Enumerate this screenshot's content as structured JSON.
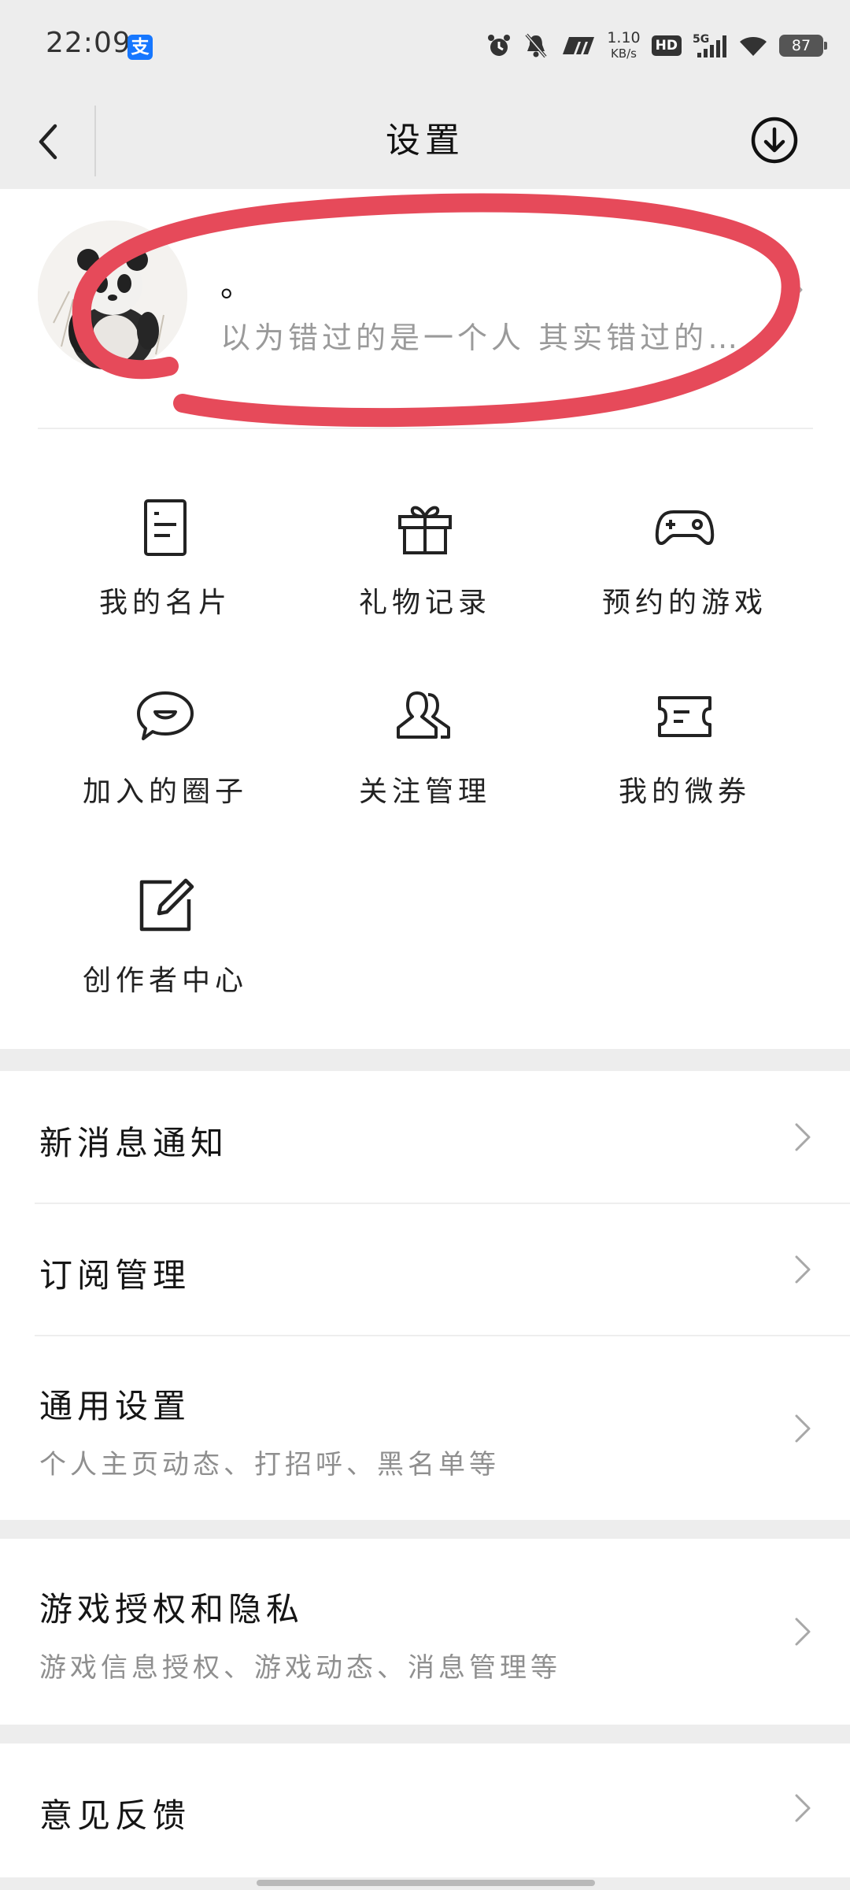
{
  "status_bar": {
    "time": "22:09",
    "alipay_icon_text": "支",
    "net_speed_value": "1.10",
    "net_speed_unit": "KB/s",
    "hd_label": "HD",
    "network_label": "5G",
    "battery": "87"
  },
  "header": {
    "title": "设置",
    "back_icon": "chevron-left-icon",
    "download_icon": "download-circle-icon"
  },
  "profile": {
    "avatar_icon": "panda-avatar",
    "nickname": "。",
    "signature": "以为错过的是一个人 其实错过的…",
    "annotation_color": "#e64a5a"
  },
  "grid": [
    {
      "label": "我的名片",
      "icon": "card-document-icon"
    },
    {
      "label": "礼物记录",
      "icon": "gift-icon"
    },
    {
      "label": "预约的游戏",
      "icon": "gamepad-icon"
    },
    {
      "label": "加入的圈子",
      "icon": "chat-bubble-icon"
    },
    {
      "label": "关注管理",
      "icon": "people-icon"
    },
    {
      "label": "我的微券",
      "icon": "ticket-icon"
    },
    {
      "label": "创作者中心",
      "icon": "edit-icon"
    }
  ],
  "settings": {
    "new_message_notify": "新消息通知",
    "subscription_manage": "订阅管理",
    "general_settings": "通用设置",
    "general_settings_sub": "个人主页动态、打招呼、黑名单等",
    "game_auth_privacy": "游戏授权和隐私",
    "game_auth_privacy_sub": "游戏信息授权、游戏动态、消息管理等",
    "feedback": "意见反馈"
  }
}
